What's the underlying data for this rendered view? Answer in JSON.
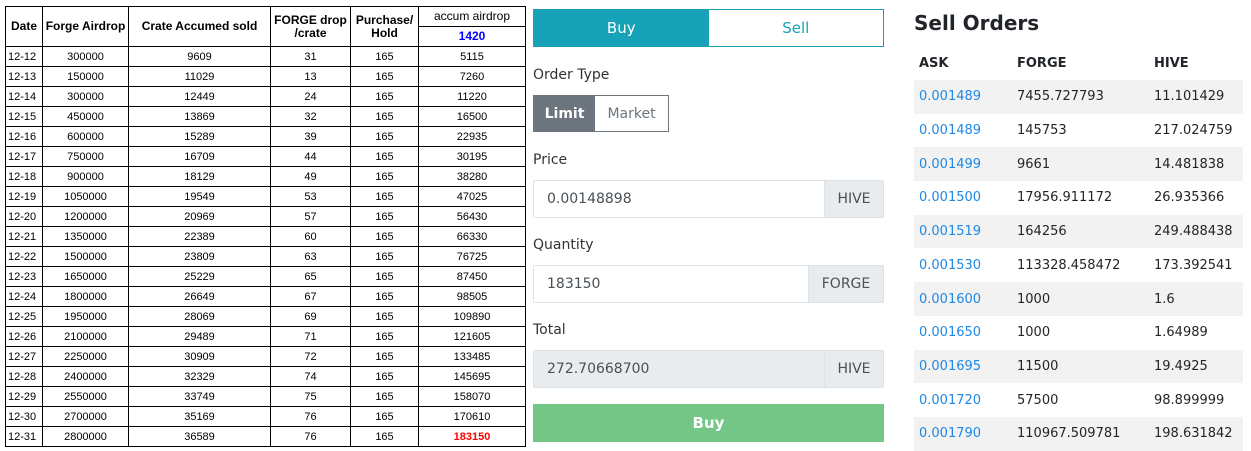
{
  "sheet": {
    "headers": {
      "date": "Date",
      "forge": "Forge Airdrop",
      "crate": "Crate Accumed sold",
      "drop": "FORGE drop /crate",
      "purchase": "Purchase/ Hold",
      "accum": "accum airdrop",
      "accum_total": "1420"
    },
    "rows": [
      [
        "12-12",
        "300000",
        "9609",
        "31",
        "165",
        "5115"
      ],
      [
        "12-13",
        "150000",
        "11029",
        "13",
        "165",
        "7260"
      ],
      [
        "12-14",
        "300000",
        "12449",
        "24",
        "165",
        "11220"
      ],
      [
        "12-15",
        "450000",
        "13869",
        "32",
        "165",
        "16500"
      ],
      [
        "12-16",
        "600000",
        "15289",
        "39",
        "165",
        "22935"
      ],
      [
        "12-17",
        "750000",
        "16709",
        "44",
        "165",
        "30195"
      ],
      [
        "12-18",
        "900000",
        "18129",
        "49",
        "165",
        "38280"
      ],
      [
        "12-19",
        "1050000",
        "19549",
        "53",
        "165",
        "47025"
      ],
      [
        "12-20",
        "1200000",
        "20969",
        "57",
        "165",
        "56430"
      ],
      [
        "12-21",
        "1350000",
        "22389",
        "60",
        "165",
        "66330"
      ],
      [
        "12-22",
        "1500000",
        "23809",
        "63",
        "165",
        "76725"
      ],
      [
        "12-23",
        "1650000",
        "25229",
        "65",
        "165",
        "87450"
      ],
      [
        "12-24",
        "1800000",
        "26649",
        "67",
        "165",
        "98505"
      ],
      [
        "12-25",
        "1950000",
        "28069",
        "69",
        "165",
        "109890"
      ],
      [
        "12-26",
        "2100000",
        "29489",
        "71",
        "165",
        "121605"
      ],
      [
        "12-27",
        "2250000",
        "30909",
        "72",
        "165",
        "133485"
      ],
      [
        "12-28",
        "2400000",
        "32329",
        "74",
        "165",
        "145695"
      ],
      [
        "12-29",
        "2550000",
        "33749",
        "75",
        "165",
        "158070"
      ],
      [
        "12-30",
        "2700000",
        "35169",
        "76",
        "165",
        "170610"
      ],
      [
        "12-31",
        "2800000",
        "36589",
        "76",
        "165",
        "183150"
      ]
    ],
    "highlight_color": "#ff0000",
    "total_color": "#0000ff"
  },
  "form": {
    "tab_buy": "Buy",
    "tab_sell": "Sell",
    "order_type_label": "Order Type",
    "limit": "Limit",
    "market": "Market",
    "price_label": "Price",
    "price_value": "0.00148898",
    "price_unit": "HIVE",
    "quantity_label": "Quantity",
    "quantity_value": "183150",
    "quantity_unit": "FORGE",
    "total_label": "Total",
    "total_value": "272.70668700",
    "total_unit": "HIVE",
    "submit": "Buy",
    "accent": "#17a2b8",
    "buy_color": "#74c687"
  },
  "orders": {
    "title": "Sell Orders",
    "col_ask": "ASK",
    "col_forge": "FORGE",
    "col_hive": "HIVE",
    "rows": [
      [
        "0.001489",
        "7455.727793",
        "11.101429"
      ],
      [
        "0.001489",
        "145753",
        "217.024759"
      ],
      [
        "0.001499",
        "9661",
        "14.481838"
      ],
      [
        "0.001500",
        "17956.911172",
        "26.935366"
      ],
      [
        "0.001519",
        "164256",
        "249.488438"
      ],
      [
        "0.001530",
        "113328.458472",
        "173.392541"
      ],
      [
        "0.001600",
        "1000",
        "1.6"
      ],
      [
        "0.001650",
        "1000",
        "1.64989"
      ],
      [
        "0.001695",
        "11500",
        "19.4925"
      ],
      [
        "0.001720",
        "57500",
        "98.899999"
      ],
      [
        "0.001790",
        "110967.509781",
        "198.631842"
      ]
    ],
    "link_color": "#1e88e5"
  }
}
